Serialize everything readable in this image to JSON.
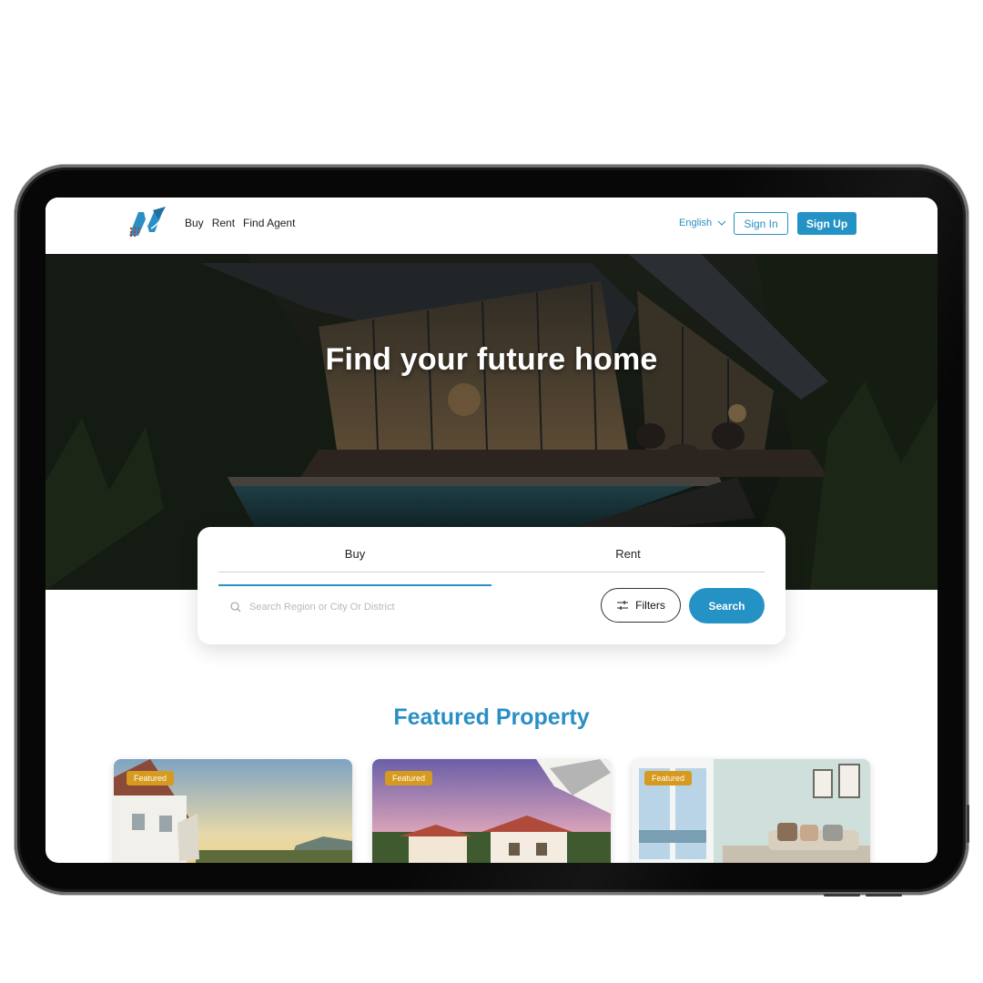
{
  "nav": {
    "links": [
      "Buy",
      "Rent",
      "Find Agent"
    ],
    "language": "English",
    "sign_in": "Sign In",
    "sign_up": "Sign Up"
  },
  "hero": {
    "title": "Find your future home"
  },
  "search": {
    "tabs": [
      "Buy",
      "Rent"
    ],
    "active_tab": "Buy",
    "placeholder": "Search Region or City Or District",
    "filters_label": "Filters",
    "search_label": "Search"
  },
  "featured": {
    "title": "Featured Property",
    "cards": [
      {
        "badge": "Featured"
      },
      {
        "badge": "Featured"
      },
      {
        "badge": "Featured"
      }
    ]
  },
  "colors": {
    "accent": "#2492c5",
    "badge": "#d59a1e"
  }
}
